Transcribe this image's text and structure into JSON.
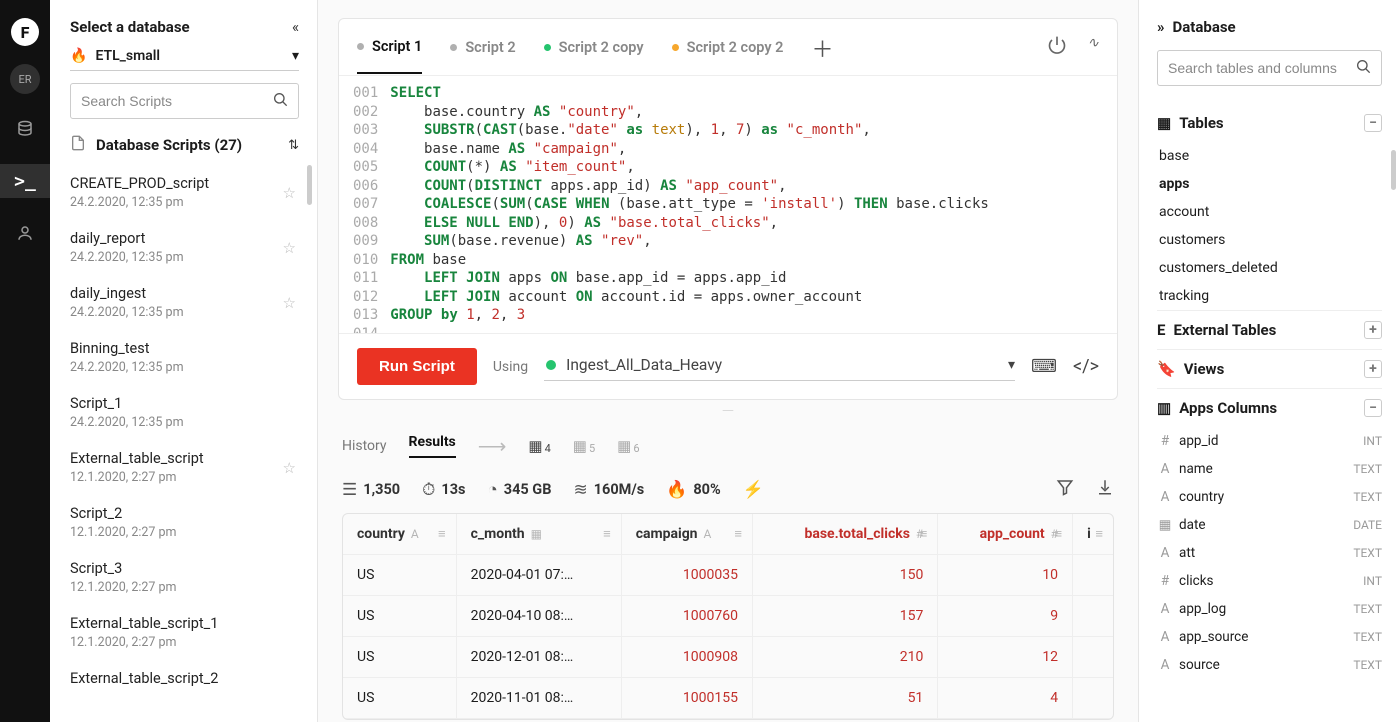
{
  "rail": {
    "avatar_initials": "ER"
  },
  "left": {
    "title": "Select a database",
    "db_name": "ETL_small",
    "search_placeholder": "Search Scripts",
    "scripts_header": "Database Scripts (27)",
    "scripts": [
      {
        "name": "CREATE_PROD_script",
        "date": "24.2.2020, 12:35 pm",
        "starred": true
      },
      {
        "name": "daily_report",
        "date": "24.2.2020, 12:35 pm",
        "starred": true
      },
      {
        "name": "daily_ingest",
        "date": "24.2.2020, 12:35 pm",
        "starred": true
      },
      {
        "name": "Binning_test",
        "date": "24.2.2020, 12:35 pm",
        "starred": false
      },
      {
        "name": "Script_1",
        "date": "24.2.2020, 12:35 pm",
        "starred": false
      },
      {
        "name": "External_table_script",
        "date": "12.1.2020, 2:27 pm",
        "starred": true
      },
      {
        "name": "Script_2",
        "date": "12.1.2020, 2:27 pm",
        "starred": false
      },
      {
        "name": "Script_3",
        "date": "12.1.2020, 2:27 pm",
        "starred": false
      },
      {
        "name": "External_table_script_1",
        "date": "12.1.2020, 2:27 pm",
        "starred": false
      },
      {
        "name": "External_table_script_2",
        "date": "",
        "starred": false
      }
    ]
  },
  "main": {
    "tabs": [
      {
        "label": "Script 1",
        "status": "gray",
        "active": true
      },
      {
        "label": "Script 2",
        "status": "gray",
        "active": false
      },
      {
        "label": "Script 2 copy",
        "status": "green",
        "active": false
      },
      {
        "label": "Script 2 copy 2",
        "status": "orange",
        "active": false
      }
    ],
    "code_lines": [
      "SELECT",
      "    base.country AS \"country\",",
      "    SUBSTR(CAST(base.\"date\" as text), 1, 7) as \"c_month\",",
      "    base.name AS \"campaign\",",
      "    COUNT(*) AS \"item_count\",",
      "    COUNT(DISTINCT apps.app_id) AS \"app_count\",",
      "    COALESCE(SUM(CASE WHEN (base.att_type = 'install') THEN base.clicks",
      "    ELSE NULL END), 0) AS \"base.total_clicks\",",
      "    SUM(base.revenue) AS \"rev\",",
      "FROM base",
      "    LEFT JOIN apps ON base.app_id = apps.app_id",
      "    LEFT JOIN account ON account.id = apps.owner_account",
      "GROUP by 1, 2, 3",
      ""
    ],
    "run_label": "Run Script",
    "using_label": "Using",
    "engine": "Ingest_All_Data_Heavy",
    "results_tabs": {
      "history": "History",
      "results": "Results",
      "counts": [
        "4",
        "5",
        "6"
      ]
    },
    "stats": {
      "rows": "1,350",
      "elapsed": "13s",
      "scanned": "345 GB",
      "throughput": "160M/s",
      "hot": "80%"
    },
    "columns": [
      {
        "name": "country",
        "type": "A"
      },
      {
        "name": "c_month",
        "type": "date"
      },
      {
        "name": "campaign",
        "type": "A"
      },
      {
        "name": "base.total_clicks",
        "type": "#"
      },
      {
        "name": "app_count",
        "type": "#"
      },
      {
        "name": "i",
        "type": ""
      }
    ],
    "rows": [
      {
        "country": "US",
        "c_month": "2020-04-01 07:…",
        "campaign": "1000035",
        "clicks": "150",
        "app_count": "10"
      },
      {
        "country": "US",
        "c_month": "2020-04-10 08:…",
        "campaign": "1000760",
        "clicks": "157",
        "app_count": "9"
      },
      {
        "country": "US",
        "c_month": "2020-12-01 08:…",
        "campaign": "1000908",
        "clicks": "210",
        "app_count": "12"
      },
      {
        "country": "US",
        "c_month": "2020-11-01 08:…",
        "campaign": "1000155",
        "clicks": "51",
        "app_count": "4"
      }
    ]
  },
  "right": {
    "title": "Database",
    "search_placeholder": "Search tables and columns",
    "tables_label": "Tables",
    "tables": [
      "base",
      "apps",
      "account",
      "customers",
      "customers_deleted",
      "tracking"
    ],
    "tables_selected": "apps",
    "ext_label": "External Tables",
    "views_label": "Views",
    "cols_label": "Apps Columns",
    "cols": [
      {
        "icon": "#",
        "name": "app_id",
        "type": "INT"
      },
      {
        "icon": "A",
        "name": "name",
        "type": "TEXT"
      },
      {
        "icon": "A",
        "name": "country",
        "type": "TEXT"
      },
      {
        "icon": "▦",
        "name": "date",
        "type": "DATE"
      },
      {
        "icon": "A",
        "name": "att",
        "type": "TEXT"
      },
      {
        "icon": "#",
        "name": "clicks",
        "type": "INT"
      },
      {
        "icon": "A",
        "name": "app_log",
        "type": "TEXT"
      },
      {
        "icon": "A",
        "name": "app_source",
        "type": "TEXT"
      },
      {
        "icon": "A",
        "name": "source",
        "type": "TEXT"
      }
    ]
  }
}
